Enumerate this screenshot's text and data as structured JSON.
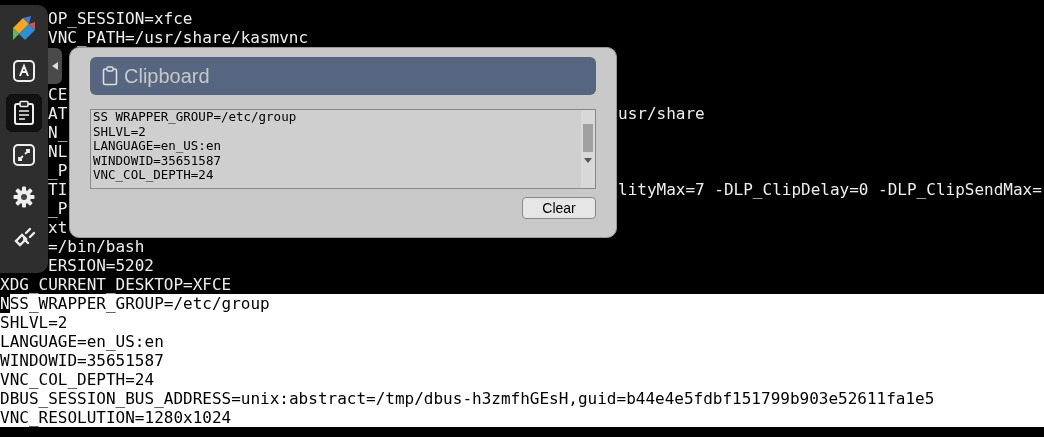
{
  "terminal": {
    "lines": [
      {
        "text": "OP_SESSION=xfce",
        "inverted": false,
        "cursor": false
      },
      {
        "text": "VNC_PATH=/usr/share/kasmvnc",
        "inverted": false,
        "cursor": false
      },
      {
        "inverted": false,
        "cursor": false
      },
      {
        "inverted": false,
        "cursor": false
      },
      {
        "text": "CE",
        "inverted": false,
        "cursor": false
      },
      {
        "text": "AT",
        "text_right": "usr/share",
        "inverted": false,
        "cursor": false
      },
      {
        "text": "N_",
        "inverted": false,
        "cursor": false
      },
      {
        "text": "NL",
        "inverted": false,
        "cursor": false
      },
      {
        "text": "_P",
        "inverted": false,
        "cursor": false
      },
      {
        "text": "TI",
        "text_right": "lityMax=7 -DLP_ClipDelay=0 -DLP_ClipSendMax=",
        "inverted": false,
        "cursor": false
      },
      {
        "text": "_P",
        "inverted": false,
        "cursor": false
      },
      {
        "text": "xt",
        "inverted": false,
        "cursor": false
      },
      {
        "text": "=/bin/bash",
        "inverted": false,
        "cursor": false
      },
      {
        "text": "ERSION=5202",
        "inverted": false,
        "cursor": false
      },
      {
        "text": "XDG_CURRENT_DESKTOP=XFCE",
        "inverted": false,
        "cursor": false
      },
      {
        "text": "NSS_WRAPPER_GROUP=/etc/group",
        "inverted": true,
        "cursor": true
      },
      {
        "text": "SHLVL=2",
        "inverted": true,
        "cursor": false
      },
      {
        "text": "LANGUAGE=en_US:en",
        "inverted": true,
        "cursor": false
      },
      {
        "text": "WINDOWID=35651587",
        "inverted": true,
        "cursor": false
      },
      {
        "text": "VNC_COL_DEPTH=24",
        "inverted": true,
        "cursor": false
      },
      {
        "text": "DBUS_SESSION_BUS_ADDRESS=unix:abstract=/tmp/dbus-h3zmfhGEsH,guid=b44e4e5fdbf151799b903e52611fa1e5",
        "inverted": true,
        "cursor": false
      },
      {
        "text": "VNC_RESOLUTION=1280x1024",
        "inverted": true,
        "cursor": false
      }
    ]
  },
  "sidebar": {
    "items": [
      {
        "kind": "logo",
        "selected": false
      },
      {
        "kind": "keyboard",
        "selected": false
      },
      {
        "kind": "clipboard",
        "selected": true
      },
      {
        "kind": "fullscreen",
        "selected": false
      },
      {
        "kind": "settings",
        "selected": false
      },
      {
        "kind": "disconnect",
        "selected": false
      }
    ]
  },
  "clipboard_panel": {
    "title": "Clipboard",
    "content_lines": [
      "SS WRAPPER_GROUP=/etc/group",
      "SHLVL=2",
      "LANGUAGE=en_US:en",
      "WINDOWID=35651587",
      "VNC_COL_DEPTH=24"
    ],
    "button": "Clear"
  }
}
